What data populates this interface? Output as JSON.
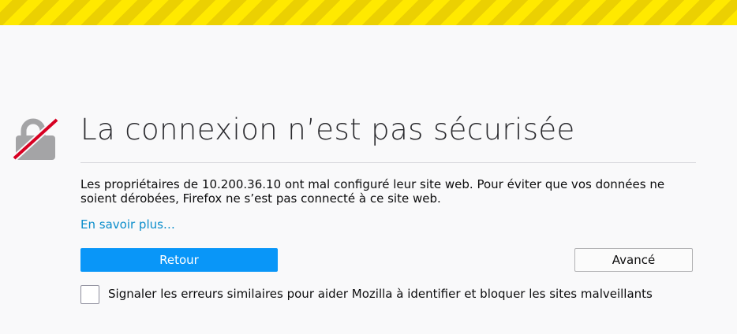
{
  "page": {
    "title": "La connexion n’est pas sécurisée",
    "description": "Les propriétaires de 10.200.36.10 ont mal configuré leur site web. Pour éviter que vos données ne soient dérobées, Firefox ne s’est pas connecté à ce site web.",
    "learn_more": "En savoir plus…"
  },
  "buttons": {
    "back": "Retour",
    "advanced": "Avancé"
  },
  "report": {
    "checked": false,
    "label": "Signaler les erreurs similaires pour aider Mozilla à identifier et bloquer les sites malveillants"
  },
  "icons": {
    "warning_stripe": "warning-stripe",
    "lock": "broken-lock-icon"
  },
  "colors": {
    "stripe_yellow": "#ffe900",
    "stripe_dark_yellow": "#ebd002",
    "primary_button": "#0996f8",
    "link": "#0a8dcb",
    "lock_gray": "#a4a4a6",
    "slash_red": "#d70022"
  }
}
